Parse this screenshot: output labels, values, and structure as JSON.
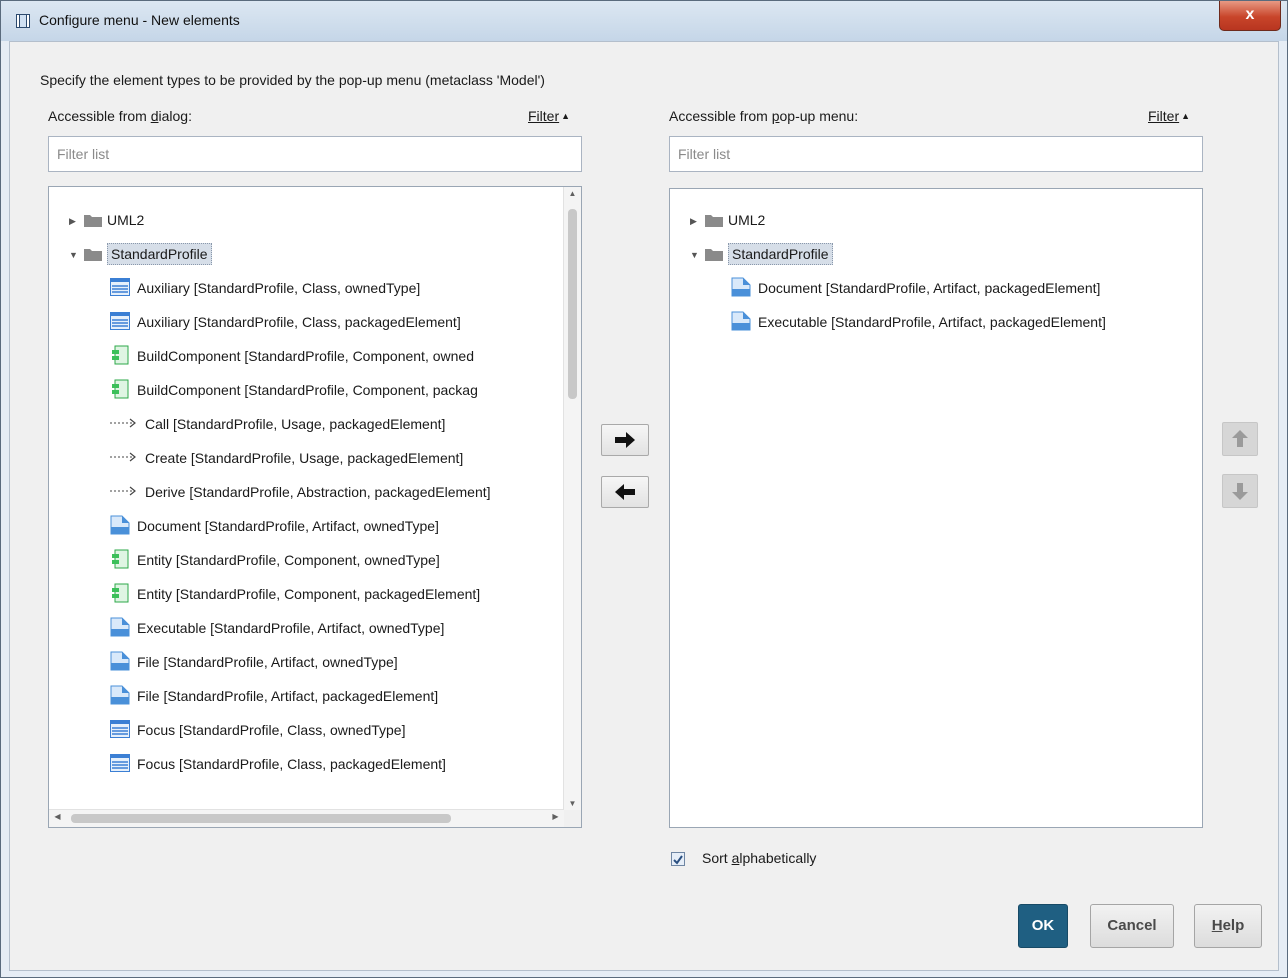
{
  "window": {
    "title": "Configure menu - New elements",
    "close_label": "x"
  },
  "instruction": "Specify the element types to be provided by the pop-up menu (metaclass 'Model')",
  "left_panel": {
    "label_before": "Accessible from ",
    "label_mnemonic": "d",
    "label_after": "ialog:",
    "filter_link": "Filter",
    "filter_placeholder": "Filter list",
    "tree": [
      {
        "text": "UML2",
        "kind": "folder",
        "expanded": false,
        "selected": false
      },
      {
        "text": "StandardProfile",
        "kind": "folder",
        "expanded": true,
        "selected": true
      },
      {
        "text": "Auxiliary [StandardProfile, Class, ownedType]",
        "kind": "class"
      },
      {
        "text": "Auxiliary [StandardProfile, Class, packagedElement]",
        "kind": "class"
      },
      {
        "text": "BuildComponent [StandardProfile, Component, owned",
        "kind": "component"
      },
      {
        "text": "BuildComponent [StandardProfile, Component, packag",
        "kind": "component"
      },
      {
        "text": "Call [StandardProfile, Usage, packagedElement]",
        "kind": "dependency"
      },
      {
        "text": "Create [StandardProfile, Usage, packagedElement]",
        "kind": "dependency"
      },
      {
        "text": "Derive [StandardProfile, Abstraction, packagedElement]",
        "kind": "dependency"
      },
      {
        "text": "Document [StandardProfile, Artifact, ownedType]",
        "kind": "artifact"
      },
      {
        "text": "Entity [StandardProfile, Component, ownedType]",
        "kind": "component"
      },
      {
        "text": "Entity [StandardProfile, Component, packagedElement]",
        "kind": "component"
      },
      {
        "text": "Executable [StandardProfile, Artifact, ownedType]",
        "kind": "artifact"
      },
      {
        "text": "File [StandardProfile, Artifact, ownedType]",
        "kind": "artifact"
      },
      {
        "text": "File [StandardProfile, Artifact, packagedElement]",
        "kind": "artifact"
      },
      {
        "text": "Focus [StandardProfile, Class, ownedType]",
        "kind": "class"
      },
      {
        "text": "Focus [StandardProfile, Class, packagedElement]",
        "kind": "class"
      }
    ]
  },
  "right_panel": {
    "label_before": "Accessible from ",
    "label_mnemonic": "p",
    "label_after": "op-up menu:",
    "filter_link": "Filter",
    "filter_placeholder": "Filter list",
    "tree": [
      {
        "text": "UML2",
        "kind": "folder",
        "expanded": false,
        "selected": false
      },
      {
        "text": "StandardProfile",
        "kind": "folder",
        "expanded": true,
        "selected": true
      },
      {
        "text": "Document [StandardProfile, Artifact, packagedElement]",
        "kind": "artifact"
      },
      {
        "text": "Executable [StandardProfile, Artifact, packagedElement]",
        "kind": "artifact"
      }
    ]
  },
  "sort": {
    "label_before": "Sort ",
    "label_mnemonic": "a",
    "label_after": "lphabetically",
    "checked": true
  },
  "buttons": {
    "ok": "OK",
    "cancel": "Cancel",
    "help_mnemonic": "H",
    "help_rest": "elp"
  },
  "colors": {
    "ok_button": "#1f5f82",
    "selection": "#d6dee8",
    "class_icon": "#3b7fd4",
    "component_icon": "#3cc05a",
    "artifact_icon": "#4a90d9"
  }
}
